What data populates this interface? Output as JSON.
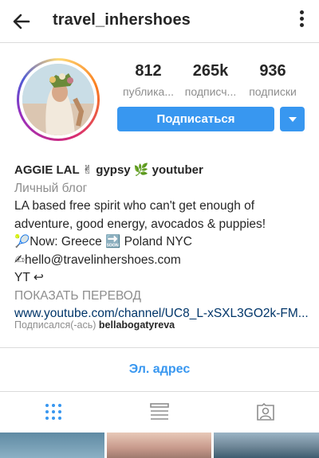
{
  "header": {
    "username": "travel_inhershoes",
    "back_icon": "arrow-left-icon",
    "more_icon": "vertical-dots-icon"
  },
  "stats": [
    {
      "value": "812",
      "label": "публика..."
    },
    {
      "value": "265k",
      "label": "подписч..."
    },
    {
      "value": "936",
      "label": "подписки"
    }
  ],
  "actions": {
    "follow_label": "Подписаться",
    "dropdown_icon": "caret-down-icon"
  },
  "bio": {
    "name": "AGGIE LAL ✌ gypsy 🌿 youtuber",
    "category": "Личный блог",
    "line1": "LA based free spirit who can't get enough of",
    "line2": "adventure, good energy, avocados & puppies!",
    "line3": "🎾Now: Greece 🔜 Poland NYC",
    "line4": "✍hello@travelinhershoes.com",
    "line5": "YT ↩",
    "translate": "ПОКАЗАТЬ ПЕРЕВОД",
    "link": "www.youtube.com/channel/UC8_L-xSXL3GO2k-FM..."
  },
  "followed_by": {
    "prefix": "Подписался(-ась)",
    "user": "bellabogatyreva"
  },
  "email_button": "Эл. адрес",
  "tabs": [
    {
      "icon": "grid-icon",
      "active": true
    },
    {
      "icon": "list-icon",
      "active": false
    },
    {
      "icon": "tagged-person-icon",
      "active": false
    }
  ],
  "colors": {
    "accent": "#3897f0",
    "link": "#003569",
    "muted": "#8e8e8e",
    "text": "#262626"
  }
}
